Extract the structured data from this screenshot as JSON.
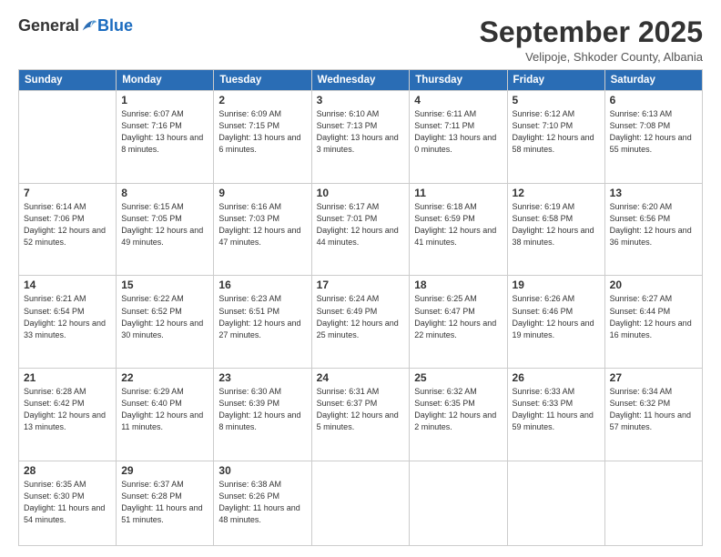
{
  "logo": {
    "general": "General",
    "blue": "Blue"
  },
  "header": {
    "month": "September 2025",
    "location": "Velipoje, Shkoder County, Albania"
  },
  "days_of_week": [
    "Sunday",
    "Monday",
    "Tuesday",
    "Wednesday",
    "Thursday",
    "Friday",
    "Saturday"
  ],
  "weeks": [
    [
      {
        "day": "",
        "sunrise": "",
        "sunset": "",
        "daylight": ""
      },
      {
        "day": "1",
        "sunrise": "Sunrise: 6:07 AM",
        "sunset": "Sunset: 7:16 PM",
        "daylight": "Daylight: 13 hours and 8 minutes."
      },
      {
        "day": "2",
        "sunrise": "Sunrise: 6:09 AM",
        "sunset": "Sunset: 7:15 PM",
        "daylight": "Daylight: 13 hours and 6 minutes."
      },
      {
        "day": "3",
        "sunrise": "Sunrise: 6:10 AM",
        "sunset": "Sunset: 7:13 PM",
        "daylight": "Daylight: 13 hours and 3 minutes."
      },
      {
        "day": "4",
        "sunrise": "Sunrise: 6:11 AM",
        "sunset": "Sunset: 7:11 PM",
        "daylight": "Daylight: 13 hours and 0 minutes."
      },
      {
        "day": "5",
        "sunrise": "Sunrise: 6:12 AM",
        "sunset": "Sunset: 7:10 PM",
        "daylight": "Daylight: 12 hours and 58 minutes."
      },
      {
        "day": "6",
        "sunrise": "Sunrise: 6:13 AM",
        "sunset": "Sunset: 7:08 PM",
        "daylight": "Daylight: 12 hours and 55 minutes."
      }
    ],
    [
      {
        "day": "7",
        "sunrise": "Sunrise: 6:14 AM",
        "sunset": "Sunset: 7:06 PM",
        "daylight": "Daylight: 12 hours and 52 minutes."
      },
      {
        "day": "8",
        "sunrise": "Sunrise: 6:15 AM",
        "sunset": "Sunset: 7:05 PM",
        "daylight": "Daylight: 12 hours and 49 minutes."
      },
      {
        "day": "9",
        "sunrise": "Sunrise: 6:16 AM",
        "sunset": "Sunset: 7:03 PM",
        "daylight": "Daylight: 12 hours and 47 minutes."
      },
      {
        "day": "10",
        "sunrise": "Sunrise: 6:17 AM",
        "sunset": "Sunset: 7:01 PM",
        "daylight": "Daylight: 12 hours and 44 minutes."
      },
      {
        "day": "11",
        "sunrise": "Sunrise: 6:18 AM",
        "sunset": "Sunset: 6:59 PM",
        "daylight": "Daylight: 12 hours and 41 minutes."
      },
      {
        "day": "12",
        "sunrise": "Sunrise: 6:19 AM",
        "sunset": "Sunset: 6:58 PM",
        "daylight": "Daylight: 12 hours and 38 minutes."
      },
      {
        "day": "13",
        "sunrise": "Sunrise: 6:20 AM",
        "sunset": "Sunset: 6:56 PM",
        "daylight": "Daylight: 12 hours and 36 minutes."
      }
    ],
    [
      {
        "day": "14",
        "sunrise": "Sunrise: 6:21 AM",
        "sunset": "Sunset: 6:54 PM",
        "daylight": "Daylight: 12 hours and 33 minutes."
      },
      {
        "day": "15",
        "sunrise": "Sunrise: 6:22 AM",
        "sunset": "Sunset: 6:52 PM",
        "daylight": "Daylight: 12 hours and 30 minutes."
      },
      {
        "day": "16",
        "sunrise": "Sunrise: 6:23 AM",
        "sunset": "Sunset: 6:51 PM",
        "daylight": "Daylight: 12 hours and 27 minutes."
      },
      {
        "day": "17",
        "sunrise": "Sunrise: 6:24 AM",
        "sunset": "Sunset: 6:49 PM",
        "daylight": "Daylight: 12 hours and 25 minutes."
      },
      {
        "day": "18",
        "sunrise": "Sunrise: 6:25 AM",
        "sunset": "Sunset: 6:47 PM",
        "daylight": "Daylight: 12 hours and 22 minutes."
      },
      {
        "day": "19",
        "sunrise": "Sunrise: 6:26 AM",
        "sunset": "Sunset: 6:46 PM",
        "daylight": "Daylight: 12 hours and 19 minutes."
      },
      {
        "day": "20",
        "sunrise": "Sunrise: 6:27 AM",
        "sunset": "Sunset: 6:44 PM",
        "daylight": "Daylight: 12 hours and 16 minutes."
      }
    ],
    [
      {
        "day": "21",
        "sunrise": "Sunrise: 6:28 AM",
        "sunset": "Sunset: 6:42 PM",
        "daylight": "Daylight: 12 hours and 13 minutes."
      },
      {
        "day": "22",
        "sunrise": "Sunrise: 6:29 AM",
        "sunset": "Sunset: 6:40 PM",
        "daylight": "Daylight: 12 hours and 11 minutes."
      },
      {
        "day": "23",
        "sunrise": "Sunrise: 6:30 AM",
        "sunset": "Sunset: 6:39 PM",
        "daylight": "Daylight: 12 hours and 8 minutes."
      },
      {
        "day": "24",
        "sunrise": "Sunrise: 6:31 AM",
        "sunset": "Sunset: 6:37 PM",
        "daylight": "Daylight: 12 hours and 5 minutes."
      },
      {
        "day": "25",
        "sunrise": "Sunrise: 6:32 AM",
        "sunset": "Sunset: 6:35 PM",
        "daylight": "Daylight: 12 hours and 2 minutes."
      },
      {
        "day": "26",
        "sunrise": "Sunrise: 6:33 AM",
        "sunset": "Sunset: 6:33 PM",
        "daylight": "Daylight: 11 hours and 59 minutes."
      },
      {
        "day": "27",
        "sunrise": "Sunrise: 6:34 AM",
        "sunset": "Sunset: 6:32 PM",
        "daylight": "Daylight: 11 hours and 57 minutes."
      }
    ],
    [
      {
        "day": "28",
        "sunrise": "Sunrise: 6:35 AM",
        "sunset": "Sunset: 6:30 PM",
        "daylight": "Daylight: 11 hours and 54 minutes."
      },
      {
        "day": "29",
        "sunrise": "Sunrise: 6:37 AM",
        "sunset": "Sunset: 6:28 PM",
        "daylight": "Daylight: 11 hours and 51 minutes."
      },
      {
        "day": "30",
        "sunrise": "Sunrise: 6:38 AM",
        "sunset": "Sunset: 6:26 PM",
        "daylight": "Daylight: 11 hours and 48 minutes."
      },
      {
        "day": "",
        "sunrise": "",
        "sunset": "",
        "daylight": ""
      },
      {
        "day": "",
        "sunrise": "",
        "sunset": "",
        "daylight": ""
      },
      {
        "day": "",
        "sunrise": "",
        "sunset": "",
        "daylight": ""
      },
      {
        "day": "",
        "sunrise": "",
        "sunset": "",
        "daylight": ""
      }
    ]
  ]
}
